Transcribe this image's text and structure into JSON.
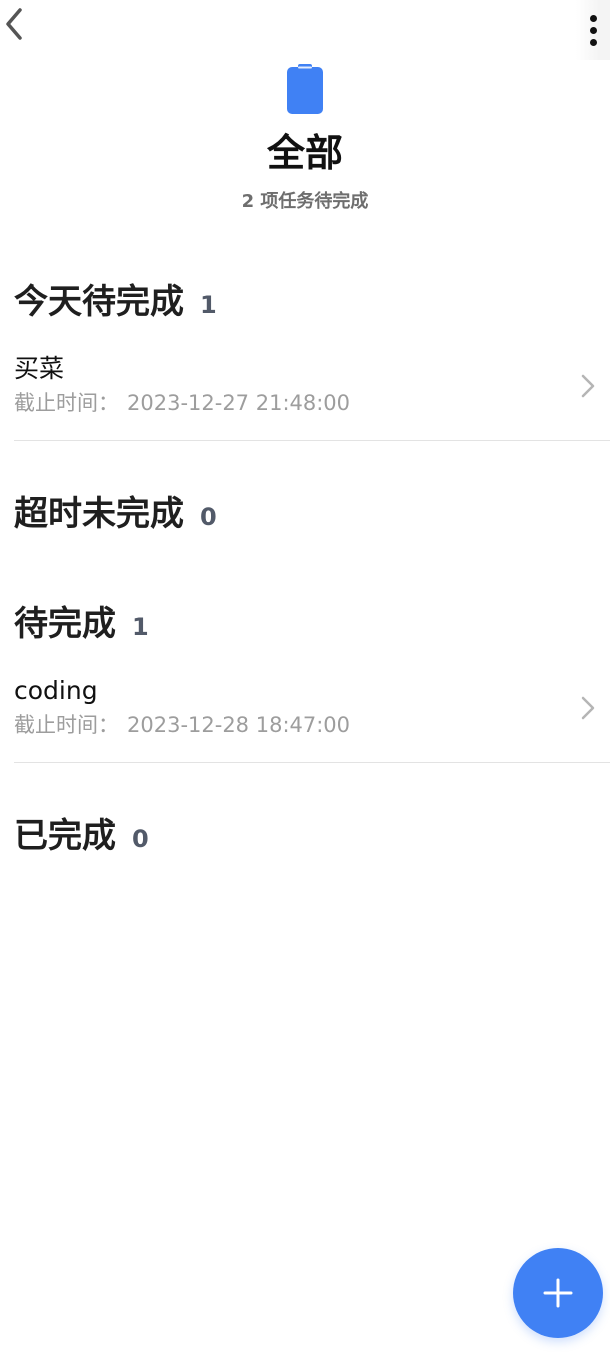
{
  "nav": {
    "back_icon": "chevron-left-icon",
    "more_icon": "vertical-dots-icon"
  },
  "header": {
    "icon": "clipboard-icon",
    "icon_color": "#4081f4",
    "title": "全部",
    "subtitle": "2 项任务待完成"
  },
  "sections": [
    {
      "title": "今天待完成",
      "count": "1",
      "tasks": [
        {
          "name": "买菜",
          "deadline_label": "截止时间：",
          "deadline": "2023-12-27 21:48:00"
        }
      ]
    },
    {
      "title": "超时未完成",
      "count": "0",
      "tasks": []
    },
    {
      "title": "待完成",
      "count": "1",
      "tasks": [
        {
          "name": "coding",
          "deadline_label": "截止时间：",
          "deadline": "2023-12-28 18:47:00"
        }
      ]
    },
    {
      "title": "已完成",
      "count": "0",
      "tasks": []
    }
  ],
  "fab": {
    "icon": "plus-icon",
    "color": "#4081f4"
  }
}
